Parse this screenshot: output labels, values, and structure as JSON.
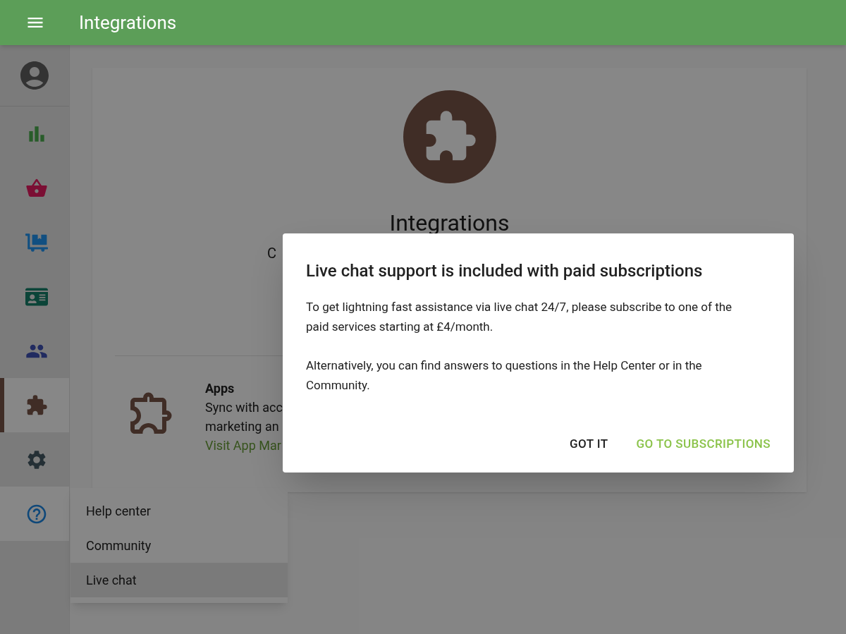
{
  "header": {
    "title": "Integrations"
  },
  "sidebar": {
    "items": [
      {
        "selected": false,
        "expanded": false
      },
      {
        "selected": false,
        "expanded": false
      },
      {
        "selected": false,
        "expanded": false
      },
      {
        "selected": false,
        "expanded": false
      },
      {
        "selected": false,
        "expanded": false
      },
      {
        "selected": true,
        "expanded": false
      },
      {
        "selected": false,
        "expanded": false
      },
      {
        "selected": false,
        "expanded": true
      }
    ]
  },
  "card": {
    "title": "Integrations",
    "subtitle_fragment": "C",
    "apps": {
      "title": "Apps",
      "lines": [
        "Sync with acc",
        "marketing an"
      ],
      "link": "Visit App Mar"
    }
  },
  "help_menu": {
    "items": [
      {
        "label": "Help center",
        "selected": false
      },
      {
        "label": "Community",
        "selected": false
      },
      {
        "label": "Live chat",
        "selected": true
      }
    ]
  },
  "dialog": {
    "title": "Live chat support is included with paid subscriptions",
    "paragraphs": [
      "To get lightning fast assistance via live chat 24/7, please subscribe to one of the paid services starting at £4/month.",
      "Alternatively, you can find answers to questions in the Help Center or in the Community."
    ],
    "buttons": [
      {
        "label": "GOT IT",
        "kind": "secondary"
      },
      {
        "label": "GO TO SUBSCRIPTIONS",
        "kind": "primary"
      }
    ]
  }
}
